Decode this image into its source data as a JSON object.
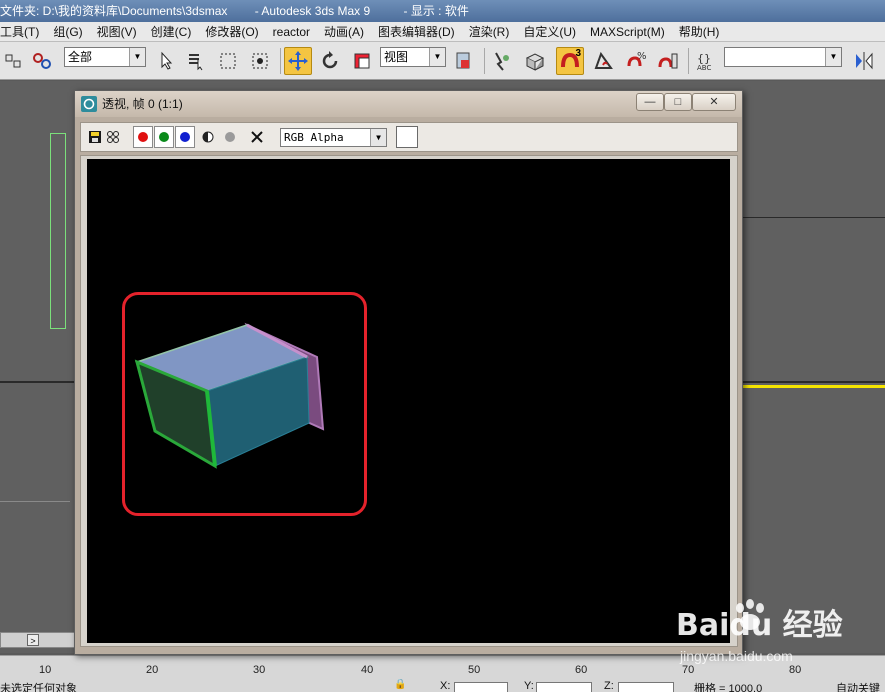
{
  "window": {
    "title_parts": [
      "文件夹: D:\\我的资料库\\Documents\\3dsmax",
      "- Autodesk 3ds Max 9",
      "- 显示 : 软件"
    ]
  },
  "menu": [
    "工具(T)",
    "组(G)",
    "视图(V)",
    "创建(C)",
    "修改器(O)",
    "reactor",
    "动画(A)",
    "图表编辑器(D)",
    "渲染(R)",
    "自定义(U)",
    "MAXScript(M)",
    "帮助(H)"
  ],
  "toolbar": {
    "selection_filter": "全部",
    "reference_coord": "视图",
    "snap_toggle_badge": "3",
    "angle_snap_badge": "",
    "named_selection": ""
  },
  "render_window": {
    "title": "透视, 帧 0 (1:1)",
    "minimize": "—",
    "maximize": "□",
    "close": "✕",
    "channel_select": "RGB Alpha",
    "channels": {
      "red": "#e01010",
      "green": "#0a8a1a",
      "blue": "#1020d0"
    }
  },
  "ruler": {
    "ticks": [
      "10",
      "20",
      "30",
      "40",
      "50",
      "60",
      "70",
      "80"
    ]
  },
  "status": {
    "prompt": "未选定任何对象",
    "x_label": "X:",
    "y_label": "Y:",
    "z_label": "Z:",
    "grid_label": "栅格 = 1000.0",
    "autokey_label": "自动关键"
  },
  "watermark": {
    "brand": "Baidu 经验",
    "site": "jingyan.baidu.com"
  },
  "colors": {
    "highlight": "#e4222b",
    "active_tool": "#f4c542",
    "timeline": "#f5e400"
  }
}
